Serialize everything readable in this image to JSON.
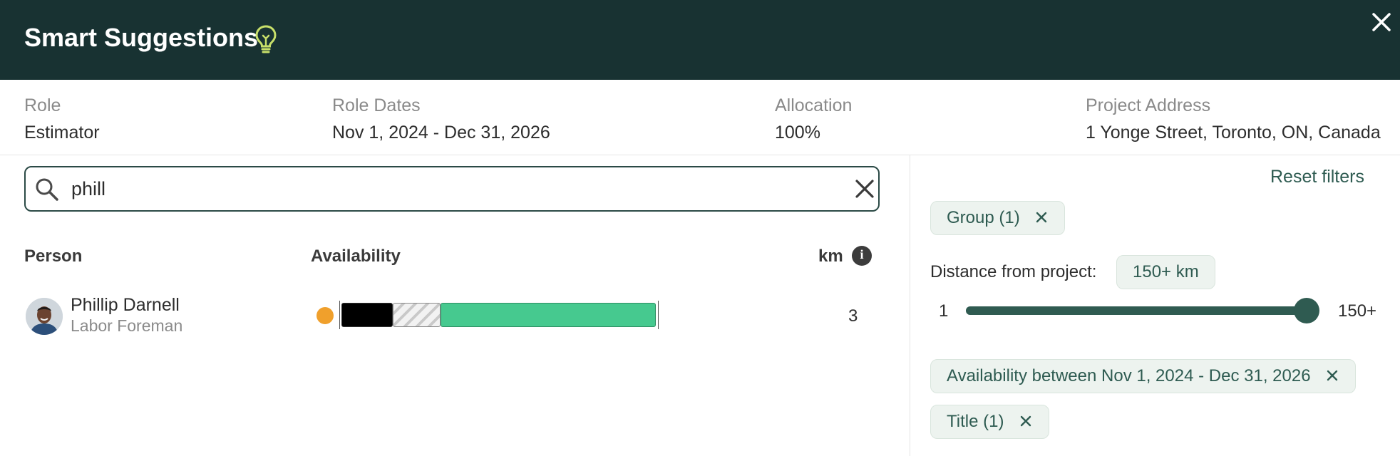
{
  "header": {
    "title": "Smart Suggestions",
    "icon": "lightbulb-icon",
    "close_icon": "close-icon"
  },
  "info": {
    "role_label": "Role",
    "role_value": "Estimator",
    "dates_label": "Role Dates",
    "dates_value": "Nov 1, 2024 - Dec 31, 2026",
    "allocation_label": "Allocation",
    "allocation_value": "100%",
    "address_label": "Project Address",
    "address_value": "1 Yonge Street, Toronto, ON, Canada"
  },
  "search": {
    "value": "phill",
    "icon": "search-icon",
    "clear_icon": "close-icon"
  },
  "table": {
    "columns": {
      "person": "Person",
      "availability": "Availability",
      "km": "km"
    },
    "rows": [
      {
        "name": "Phillip Darnell",
        "title": "Labor Foreman",
        "status_color": "#f0a02c",
        "km": "3",
        "availability_segments": [
          {
            "type": "booked",
            "color": "#000000"
          },
          {
            "type": "partial",
            "color": "#d9d9d9"
          },
          {
            "type": "available",
            "color": "#46c98f"
          }
        ]
      }
    ]
  },
  "filters": {
    "reset_label": "Reset filters",
    "group_chip": "Group (1)",
    "distance_label": "Distance from project:",
    "distance_chip": "150+ km",
    "slider_min": "1",
    "slider_max": "150+",
    "slider_value_fraction": 1.0,
    "availability_chip": "Availability between Nov 1, 2024 - Dec 31, 2026",
    "title_chip": "Title (1)"
  },
  "colors": {
    "header_bg": "#183232",
    "accent": "#2f5b51",
    "bulb": "#c8e06a"
  }
}
